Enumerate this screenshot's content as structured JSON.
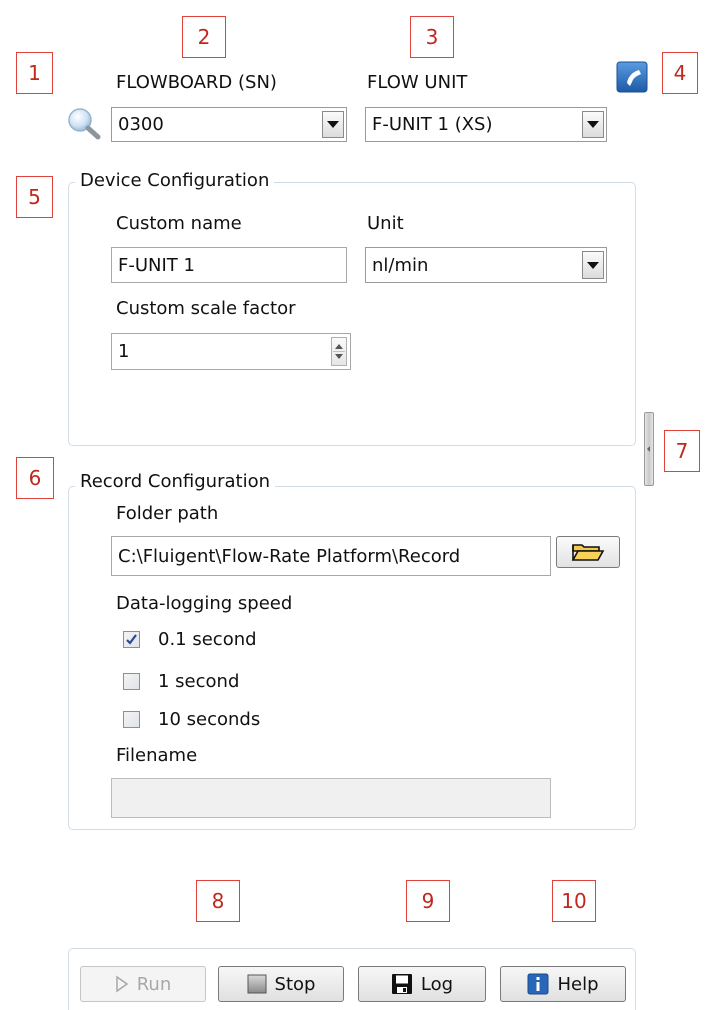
{
  "callouts": [
    "1",
    "2",
    "3",
    "4",
    "5",
    "6",
    "7",
    "8",
    "9",
    "10"
  ],
  "header": {
    "flowboard_label": "FLOWBOARD (SN)",
    "flowboard_value": "0300",
    "flowunit_label": "FLOW UNIT",
    "flowunit_value": "F-UNIT 1 (XS)",
    "search_icon": "magnifier-icon",
    "phone_icon": "phone-icon"
  },
  "device_config": {
    "title": "Device Configuration",
    "custom_name_label": "Custom name",
    "custom_name_value": "F-UNIT 1",
    "unit_label": "Unit",
    "unit_value": "nl/min",
    "scale_label": "Custom scale factor",
    "scale_value": "1"
  },
  "record_config": {
    "title": "Record Configuration",
    "folder_label": "Folder path",
    "folder_value": "C:\\Fluigent\\Flow-Rate Platform\\Record",
    "speed_label": "Data-logging speed",
    "speed_options": [
      {
        "label": "0.1 second",
        "checked": true
      },
      {
        "label": "1 second",
        "checked": false
      },
      {
        "label": "10 seconds",
        "checked": false
      }
    ],
    "filename_label": "Filename",
    "filename_value": ""
  },
  "toolbar": {
    "run_label": "Run",
    "stop_label": "Stop",
    "log_label": "Log",
    "help_label": "Help"
  },
  "colors": {
    "callout_border": "#e0413a",
    "group_border": "#d3dbe3",
    "phone_blue": "#2f74c0",
    "help_blue": "#2a66b8"
  }
}
